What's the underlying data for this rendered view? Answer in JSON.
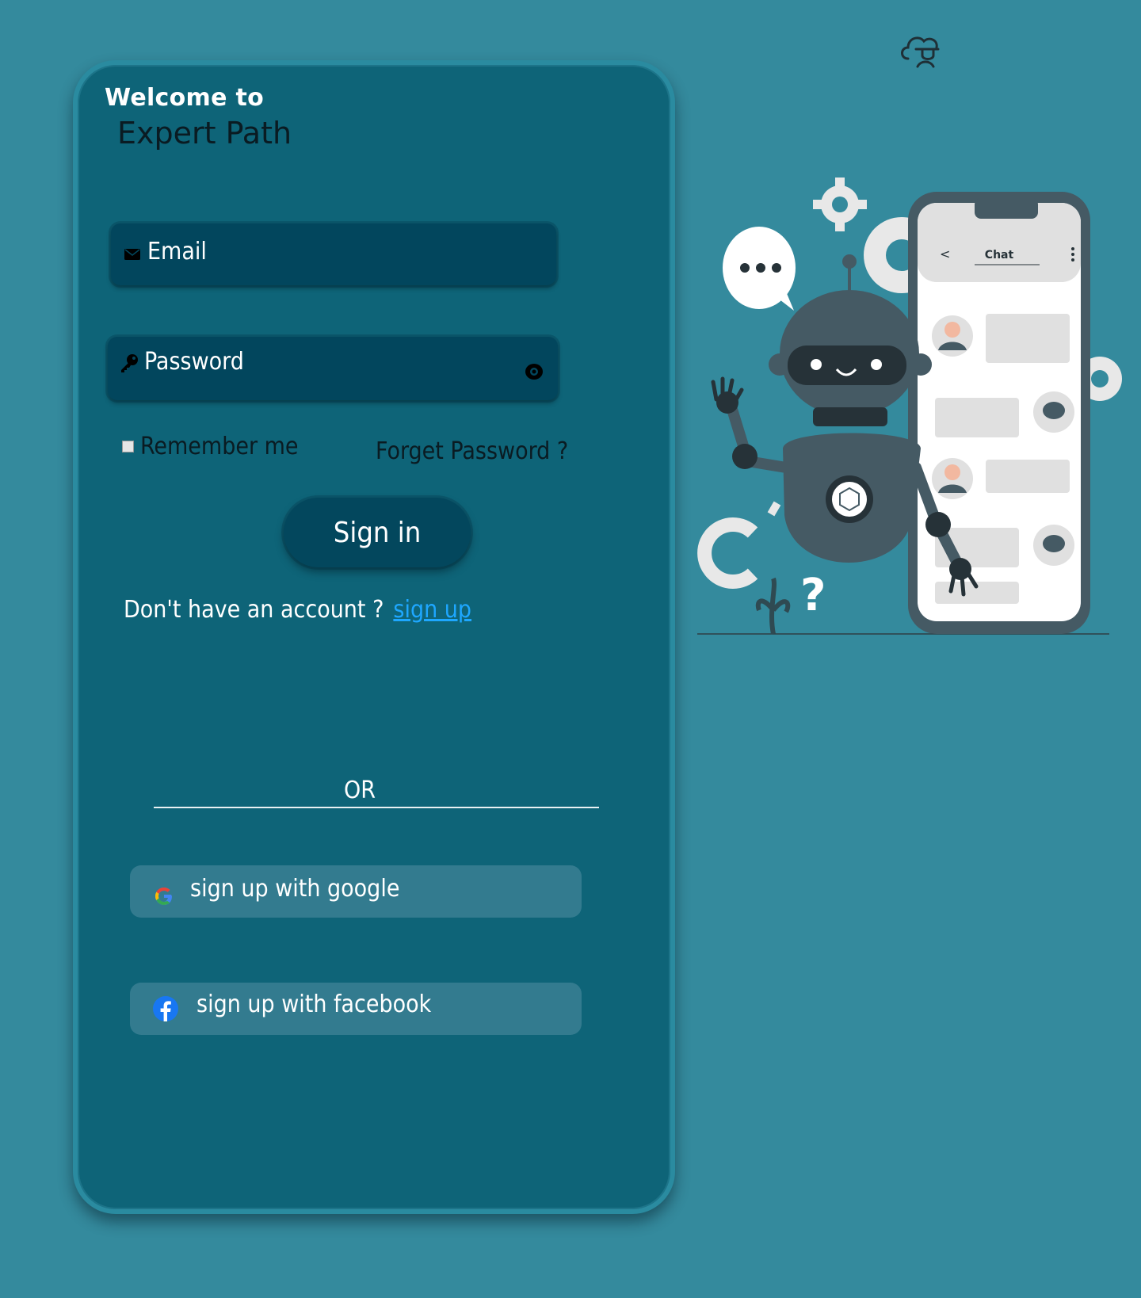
{
  "header": {
    "logo_icon": "cloud-education-logo-icon"
  },
  "card": {
    "welcome": "Welcome to",
    "brand": "Expert Path",
    "email_placeholder": "Email",
    "password_placeholder": "Password",
    "remember_label": "Remember me",
    "forget_label": "Forget Password ?",
    "signin_label": "Sign in",
    "no_account_text": "Don't have an account ?",
    "signup_link": "sign up",
    "or_text": "OR",
    "google_label": "sign up with google",
    "facebook_label": "sign up with facebook"
  },
  "illustration": {
    "chat_title": "Chat"
  },
  "colors": {
    "background": "#348a9d",
    "card": "#0e6478",
    "field": "#02465d",
    "link": "#1ea7ff",
    "social_button": "#337b8f"
  }
}
